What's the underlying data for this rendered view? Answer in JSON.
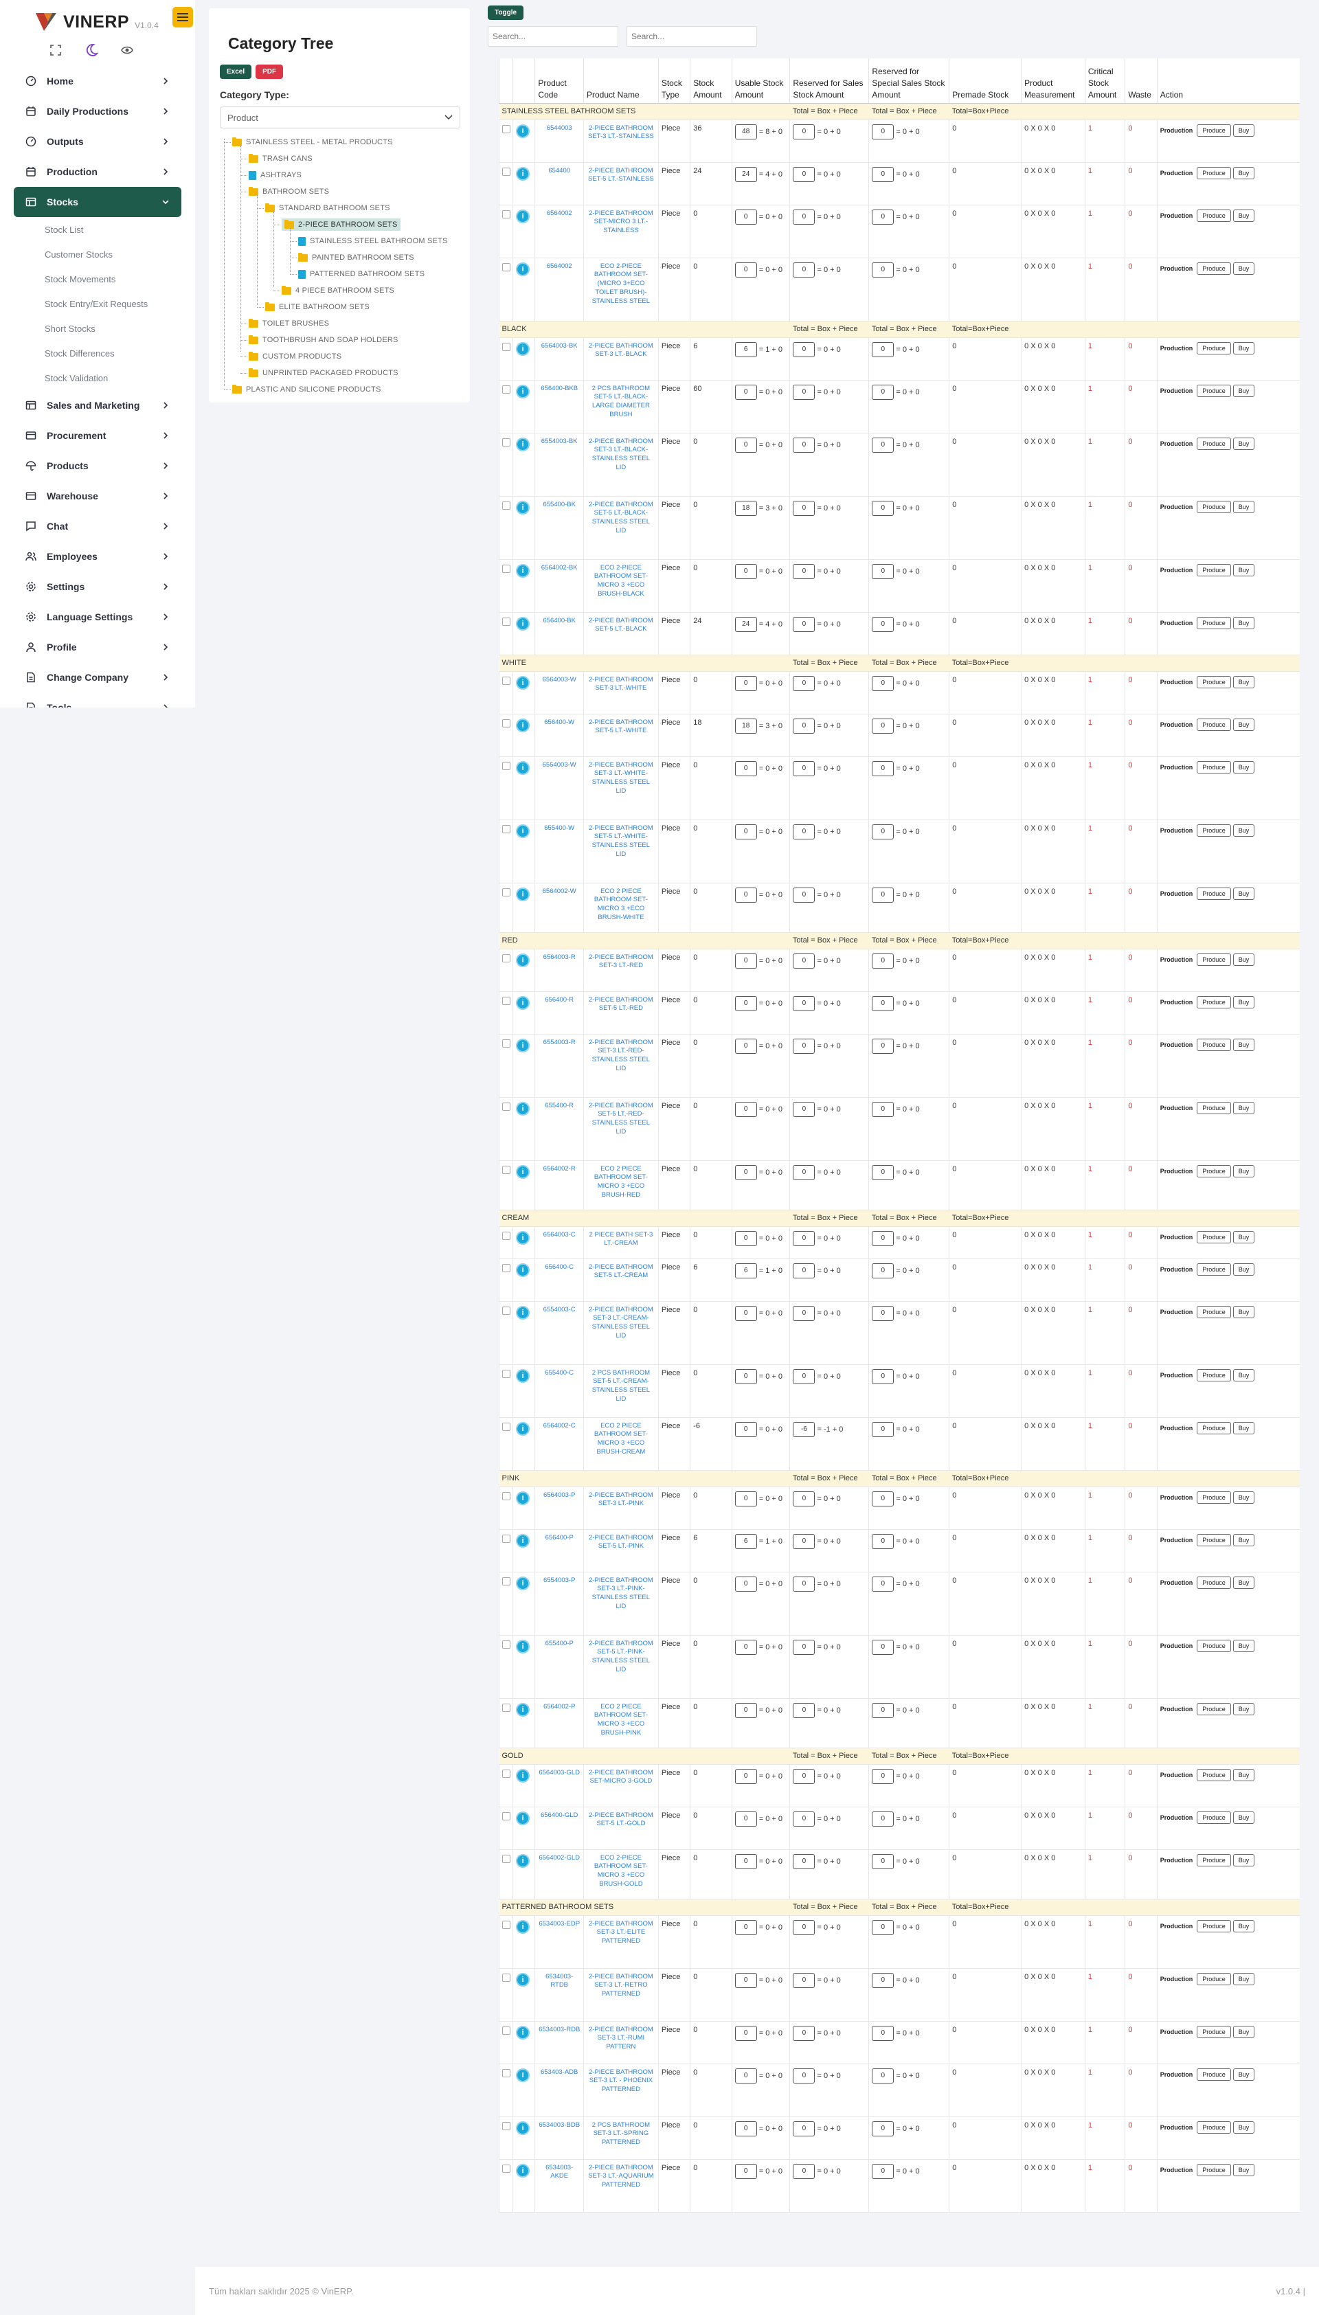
{
  "brand": {
    "name": "VINERP",
    "version": "V1.0.4"
  },
  "nav": [
    {
      "label": "Home",
      "icon": "dashboard-icon",
      "active": false
    },
    {
      "label": "Daily Productions",
      "icon": "calendar-icon",
      "active": false
    },
    {
      "label": "Outputs",
      "icon": "dashboard-icon",
      "active": false
    },
    {
      "label": "Production",
      "icon": "calendar-icon",
      "active": false
    },
    {
      "label": "Stocks",
      "icon": "table-icon",
      "active": true
    },
    {
      "label": "Sales and Marketing",
      "icon": "table-icon",
      "active": false
    },
    {
      "label": "Procurement",
      "icon": "card-icon",
      "active": false
    },
    {
      "label": "Products",
      "icon": "umbrella-icon",
      "active": false
    },
    {
      "label": "Warehouse",
      "icon": "card-icon",
      "active": false
    },
    {
      "label": "Chat",
      "icon": "chat-icon",
      "active": false
    },
    {
      "label": "Employees",
      "icon": "users-icon",
      "active": false
    },
    {
      "label": "Settings",
      "icon": "gear-icon",
      "active": false
    },
    {
      "label": "Language Settings",
      "icon": "gear-icon",
      "active": false
    },
    {
      "label": "Profile",
      "icon": "user-icon",
      "active": false
    },
    {
      "label": "Change Company",
      "icon": "document-icon",
      "active": false
    },
    {
      "label": "Tools",
      "icon": "document-icon",
      "active": false
    }
  ],
  "stock_sub": [
    "Stock List",
    "Customer Stocks",
    "Stock Movements",
    "Stock Entry/Exit Requests",
    "Short Stocks",
    "Stock Differences",
    "Stock Validation"
  ],
  "tree_card": {
    "title": "Category Tree",
    "excel": "Excel",
    "pdf": "PDF",
    "type_label": "Category Type:",
    "type_value": "Product"
  },
  "tree": [
    {
      "label": "STAINLESS STEEL - METAL PRODUCTS",
      "level": 0,
      "type": "folder"
    },
    {
      "label": "TRASH CANS",
      "level": 1,
      "type": "folder"
    },
    {
      "label": "ASHTRAYS",
      "level": 1,
      "type": "file"
    },
    {
      "label": "BATHROOM SETS",
      "level": 1,
      "type": "folder"
    },
    {
      "label": "STANDARD BATHROOM SETS",
      "level": 2,
      "type": "folder"
    },
    {
      "label": "2-PIECE BATHROOM SETS",
      "level": 3,
      "type": "folder",
      "selected": true
    },
    {
      "label": "STAINLESS STEEL BATHROOM SETS",
      "level": 4,
      "type": "file"
    },
    {
      "label": "PAINTED BATHROOM SETS",
      "level": 4,
      "type": "folder"
    },
    {
      "label": "PATTERNED BATHROOM SETS",
      "level": 4,
      "type": "file"
    },
    {
      "label": "4 PIECE BATHROOM SETS",
      "level": 3,
      "type": "folder"
    },
    {
      "label": "ELITE BATHROOM SETS",
      "level": 2,
      "type": "folder"
    },
    {
      "label": "TOILET BRUSHES",
      "level": 1,
      "type": "folder"
    },
    {
      "label": "TOOTHBRUSH AND SOAP HOLDERS",
      "level": 1,
      "type": "folder"
    },
    {
      "label": "CUSTOM PRODUCTS",
      "level": 1,
      "type": "folder"
    },
    {
      "label": "UNPRINTED PACKAGED PRODUCTS",
      "level": 1,
      "type": "folder"
    },
    {
      "label": "PLASTIC AND SILICONE PRODUCTS",
      "level": 0,
      "type": "folder"
    }
  ],
  "toolbar": {
    "toggle": "Toggle",
    "search1": "Search...",
    "search2": "Search..."
  },
  "columns": [
    "",
    "",
    "Product Code",
    "Product Name",
    "Stock Type",
    "Stock Amount",
    "Usable Stock Amount",
    "Reserved for Sales Stock Amount",
    "Reserved for Special Sales Stock Amount",
    "Premade Stock",
    "Product Measurement",
    "Critical Stock Amount",
    "Waste",
    "Action"
  ],
  "group_totals": {
    "a": "Total = Box + Piece",
    "b": "Total = Box + Piece",
    "c": "Total=Box+Piece"
  },
  "actions": {
    "production": "Production",
    "produce": "Produce",
    "buy": "Buy"
  },
  "measure": "0 X 0 X 0",
  "groups": [
    {
      "name": "STAINLESS STEEL BATHROOM SETS",
      "rows": [
        {
          "code": "6544003",
          "name": "2-PIECE BATHROOM SET-3 LT.-STAINLESS",
          "stock": "36",
          "usable": "48",
          "ub": "8",
          "up": "0",
          "rs": "0",
          "rb": "0",
          "rp": "0",
          "h": 62
        },
        {
          "code": "654400",
          "name": "2-PIECE BATHROOM SET-5 LT.-STAINLESS",
          "stock": "24",
          "usable": "24",
          "ub": "4",
          "up": "0",
          "rs": "0",
          "rb": "0",
          "rp": "0",
          "h": 62
        },
        {
          "code": "6564002",
          "name": "2-PIECE BATHROOM SET-MICRO 3 LT.-STAINLESS",
          "stock": "0",
          "usable": "0",
          "ub": "0",
          "up": "0",
          "rs": "0",
          "rb": "0",
          "rp": "0",
          "h": 77
        },
        {
          "code": "6564002",
          "name": "ECO 2-PIECE BATHROOM SET-(MICRO 3+ECO TOILET BRUSH)-STAINLESS STEEL",
          "stock": "0",
          "usable": "0",
          "ub": "0",
          "up": "0",
          "rs": "0",
          "rb": "0",
          "rp": "0",
          "h": 92
        }
      ]
    },
    {
      "name": "BLACK",
      "rows": [
        {
          "code": "6564003-BK",
          "name": "2-PIECE BATHROOM SET-3 LT.-BLACK",
          "stock": "6",
          "usable": "6",
          "ub": "1",
          "up": "0",
          "rs": "0",
          "rb": "0",
          "rp": "0",
          "h": 62
        },
        {
          "code": "656400-BKB",
          "name": "2 PCS BATHROOM SET-5 LT.-BLACK-LARGE DIAMETER BRUSH",
          "stock": "60",
          "usable": "0",
          "ub": "0",
          "up": "0",
          "rs": "0",
          "rb": "0",
          "rp": "0",
          "h": 77
        },
        {
          "code": "6554003-BK",
          "name": "2-PIECE BATHROOM SET-3 LT.-BLACK-STAINLESS STEEL LID",
          "stock": "0",
          "usable": "0",
          "ub": "0",
          "up": "0",
          "rs": "0",
          "rb": "0",
          "rp": "0",
          "h": 92
        },
        {
          "code": "655400-BK",
          "name": "2-PIECE BATHROOM SET-5 LT.-BLACK-STAINLESS STEEL LID",
          "stock": "0",
          "usable": "18",
          "ub": "3",
          "up": "0",
          "rs": "0",
          "rb": "0",
          "rp": "0",
          "h": 92
        },
        {
          "code": "6564002-BK",
          "name": "ECO 2-PIECE BATHROOM SET-MICRO 3 +ECO BRUSH-BLACK",
          "stock": "0",
          "usable": "0",
          "ub": "0",
          "up": "0",
          "rs": "0",
          "rb": "0",
          "rp": "0",
          "h": 77
        },
        {
          "code": "656400-BK",
          "name": "2-PIECE BATHROOM SET-5 LT.-BLACK",
          "stock": "24",
          "usable": "24",
          "ub": "4",
          "up": "0",
          "rs": "0",
          "rb": "0",
          "rp": "0",
          "h": 62
        }
      ]
    },
    {
      "name": "WHITE",
      "rows": [
        {
          "code": "6564003-W",
          "name": "2-PIECE BATHROOM SET-3 LT.-WHITE",
          "stock": "0",
          "usable": "0",
          "ub": "0",
          "up": "0",
          "rs": "0",
          "rb": "0",
          "rp": "0",
          "h": 62
        },
        {
          "code": "656400-W",
          "name": "2-PIECE BATHROOM SET-5 LT.-WHITE",
          "stock": "18",
          "usable": "18",
          "ub": "3",
          "up": "0",
          "rs": "0",
          "rb": "0",
          "rp": "0",
          "h": 62
        },
        {
          "code": "6554003-W",
          "name": "2-PIECE BATHROOM SET-3 LT.-WHITE-STAINLESS STEEL LID",
          "stock": "0",
          "usable": "0",
          "ub": "0",
          "up": "0",
          "rs": "0",
          "rb": "0",
          "rp": "0",
          "h": 92
        },
        {
          "code": "655400-W",
          "name": "2-PIECE BATHROOM SET-5 LT.-WHITE-STAINLESS STEEL LID",
          "stock": "0",
          "usable": "0",
          "ub": "0",
          "up": "0",
          "rs": "0",
          "rb": "0",
          "rp": "0",
          "h": 92
        },
        {
          "code": "6564002-W",
          "name": "ECO 2 PIECE BATHROOM SET-MICRO 3 +ECO BRUSH-WHITE",
          "stock": "0",
          "usable": "0",
          "ub": "0",
          "up": "0",
          "rs": "0",
          "rb": "0",
          "rp": "0",
          "h": 72
        }
      ]
    },
    {
      "name": "RED",
      "rows": [
        {
          "code": "6564003-R",
          "name": "2-PIECE BATHROOM SET-3 LT.-RED",
          "stock": "0",
          "usable": "0",
          "ub": "0",
          "up": "0",
          "rs": "0",
          "rb": "0",
          "rp": "0",
          "h": 62
        },
        {
          "code": "656400-R",
          "name": "2-PIECE BATHROOM SET-5 LT.-RED",
          "stock": "0",
          "usable": "0",
          "ub": "0",
          "up": "0",
          "rs": "0",
          "rb": "0",
          "rp": "0",
          "h": 62
        },
        {
          "code": "6554003-R",
          "name": "2-PIECE BATHROOM SET-3 LT.-RED-STAINLESS STEEL LID",
          "stock": "0",
          "usable": "0",
          "ub": "0",
          "up": "0",
          "rs": "0",
          "rb": "0",
          "rp": "0",
          "h": 92
        },
        {
          "code": "655400-R",
          "name": "2-PIECE BATHROOM SET-5 LT.-RED-STAINLESS STEEL LID",
          "stock": "0",
          "usable": "0",
          "ub": "0",
          "up": "0",
          "rs": "0",
          "rb": "0",
          "rp": "0",
          "h": 92
        },
        {
          "code": "6564002-R",
          "name": "ECO 2 PIECE BATHROOM SET-MICRO 3 +ECO BRUSH-RED",
          "stock": "0",
          "usable": "0",
          "ub": "0",
          "up": "0",
          "rs": "0",
          "rb": "0",
          "rp": "0",
          "h": 72
        }
      ]
    },
    {
      "name": "CREAM",
      "rows": [
        {
          "code": "6564003-C",
          "name": "2 PIECE BATH SET-3 LT.-CREAM",
          "stock": "0",
          "usable": "0",
          "ub": "0",
          "up": "0",
          "rs": "0",
          "rb": "0",
          "rp": "0",
          "h": 47
        },
        {
          "code": "656400-C",
          "name": "2-PIECE BATHROOM SET-5 LT.-CREAM",
          "stock": "6",
          "usable": "6",
          "ub": "1",
          "up": "0",
          "rs": "0",
          "rb": "0",
          "rp": "0",
          "h": 62
        },
        {
          "code": "6554003-C",
          "name": "2-PIECE BATHROOM SET-3 LT.-CREAM-STAINLESS STEEL LID",
          "stock": "0",
          "usable": "0",
          "ub": "0",
          "up": "0",
          "rs": "0",
          "rb": "0",
          "rp": "0",
          "h": 92
        },
        {
          "code": "655400-C",
          "name": "2 PCS BATHROOM SET-5 LT.-CREAM-STAINLESS STEEL LID",
          "stock": "0",
          "usable": "0",
          "ub": "0",
          "up": "0",
          "rs": "0",
          "rb": "0",
          "rp": "0",
          "h": 77
        },
        {
          "code": "6564002-C",
          "name": "ECO 2 PIECE BATHROOM SET-MICRO 3 +ECO BRUSH-CREAM",
          "stock": "-6",
          "usable": "0",
          "ub": "0",
          "up": "0",
          "rs": "-6",
          "rb": "-1",
          "rp": "0",
          "h": 77
        }
      ]
    },
    {
      "name": "PINK",
      "rows": [
        {
          "code": "6564003-P",
          "name": "2-PIECE BATHROOM SET-3 LT.-PINK",
          "stock": "0",
          "usable": "0",
          "ub": "0",
          "up": "0",
          "rs": "0",
          "rb": "0",
          "rp": "0",
          "h": 62
        },
        {
          "code": "656400-P",
          "name": "2-PIECE BATHROOM SET-5 LT.-PINK",
          "stock": "6",
          "usable": "6",
          "ub": "1",
          "up": "0",
          "rs": "0",
          "rb": "0",
          "rp": "0",
          "h": 62
        },
        {
          "code": "6554003-P",
          "name": "2-PIECE BATHROOM SET-3 LT.-PINK-STAINLESS STEEL LID",
          "stock": "0",
          "usable": "0",
          "ub": "0",
          "up": "0",
          "rs": "0",
          "rb": "0",
          "rp": "0",
          "h": 92
        },
        {
          "code": "655400-P",
          "name": "2-PIECE BATHROOM SET-5 LT.-PINK-STAINLESS STEEL LID",
          "stock": "0",
          "usable": "0",
          "ub": "0",
          "up": "0",
          "rs": "0",
          "rb": "0",
          "rp": "0",
          "h": 92
        },
        {
          "code": "6564002-P",
          "name": "ECO 2 PIECE BATHROOM SET-MICRO 3 +ECO BRUSH-PINK",
          "stock": "0",
          "usable": "0",
          "ub": "0",
          "up": "0",
          "rs": "0",
          "rb": "0",
          "rp": "0",
          "h": 72
        }
      ]
    },
    {
      "name": "GOLD",
      "rows": [
        {
          "code": "6564003-GLD",
          "name": "2-PIECE BATHROOM SET-MICRO 3-GOLD",
          "stock": "0",
          "usable": "0",
          "ub": "0",
          "up": "0",
          "rs": "0",
          "rb": "0",
          "rp": "0",
          "h": 62
        },
        {
          "code": "656400-GLD",
          "name": "2-PIECE BATHROOM SET-5 LT.-GOLD",
          "stock": "0",
          "usable": "0",
          "ub": "0",
          "up": "0",
          "rs": "0",
          "rb": "0",
          "rp": "0",
          "h": 62
        },
        {
          "code": "6564002-GLD",
          "name": "ECO 2-PIECE BATHROOM SET-MICRO 3 +ECO BRUSH-GOLD",
          "stock": "0",
          "usable": "0",
          "ub": "0",
          "up": "0",
          "rs": "0",
          "rb": "0",
          "rp": "0",
          "h": 72
        }
      ]
    },
    {
      "name": "PATTERNED BATHROOM SETS",
      "rows": [
        {
          "code": "6534003-EDP",
          "name": "2-PIECE BATHROOM SET-3 LT.-ELITE PATTERNED",
          "stock": "0",
          "usable": "0",
          "ub": "0",
          "up": "0",
          "rs": "0",
          "rb": "0",
          "rp": "0",
          "h": 77
        },
        {
          "code": "6534003-RTDB",
          "name": "2-PIECE BATHROOM SET-3 LT.-RETRO PATTERNED",
          "stock": "0",
          "usable": "0",
          "ub": "0",
          "up": "0",
          "rs": "0",
          "rb": "0",
          "rp": "0",
          "h": 77
        },
        {
          "code": "6534003-RDB",
          "name": "2-PIECE BATHROOM SET-3 LT.-RUMI PATTERN",
          "stock": "0",
          "usable": "0",
          "ub": "0",
          "up": "0",
          "rs": "0",
          "rb": "0",
          "rp": "0",
          "h": 62
        },
        {
          "code": "653403-ADB",
          "name": "2-PIECE BATHROOM SET-3 LT. - PHOENIX PATTERNED",
          "stock": "0",
          "usable": "0",
          "ub": "0",
          "up": "0",
          "rs": "0",
          "rb": "0",
          "rp": "0",
          "h": 77
        },
        {
          "code": "6534003-BDB",
          "name": "2 PCS BATHROOM SET-3 LT.-SPRING PATTERNED",
          "stock": "0",
          "usable": "0",
          "ub": "0",
          "up": "0",
          "rs": "0",
          "rb": "0",
          "rp": "0",
          "h": 62
        },
        {
          "code": "6534003-AKDE",
          "name": "2-PIECE BATHROOM SET-3 LT.-AQUARIUM PATTERNED",
          "stock": "0",
          "usable": "0",
          "ub": "0",
          "up": "0",
          "rs": "0",
          "rb": "0",
          "rp": "0",
          "h": 77
        }
      ]
    }
  ],
  "footer": {
    "copyright": "Tüm hakları saklıdır 2025 © VinERP.",
    "version": "v1.0.4 |"
  }
}
